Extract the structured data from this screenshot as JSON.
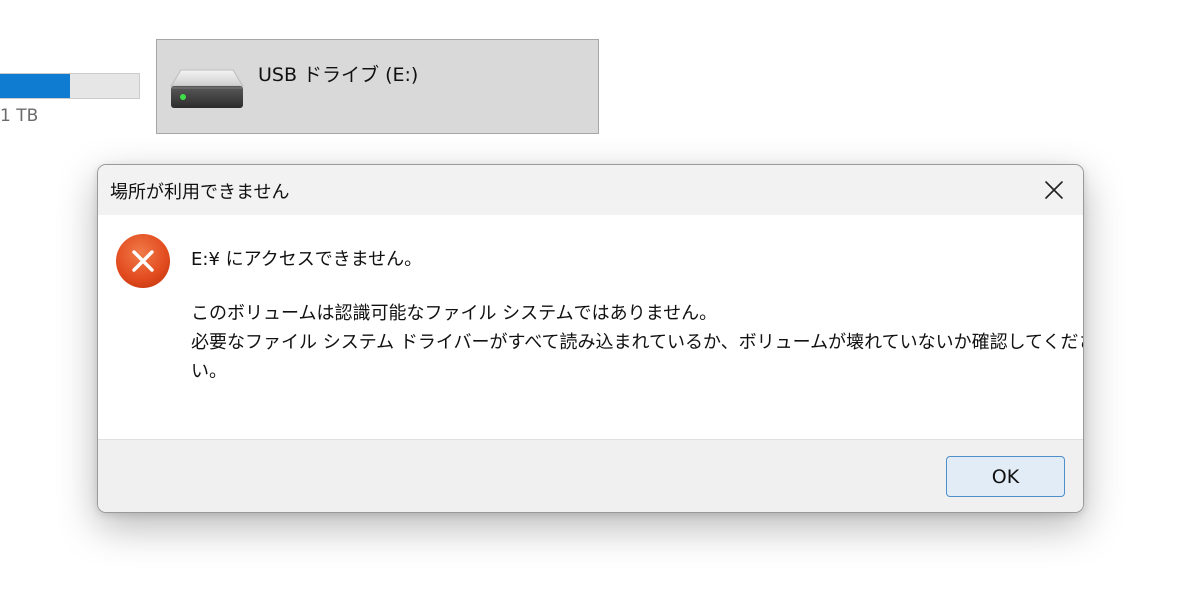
{
  "background": {
    "drive_capacity": {
      "used_fraction": 0.5,
      "size_text": "1 TB"
    },
    "usb_drive": {
      "label": "USB ドライブ (E:)",
      "icon": "usb-drive-icon"
    }
  },
  "dialog": {
    "title": "場所が利用できません",
    "close_icon": "close-icon",
    "icon": "error-icon",
    "message": "E:¥ にアクセスできません。",
    "detail_lines": [
      "このボリュームは認識可能なファイル システムではありません。",
      "必要なファイル システム ドライバーがすべて読み込まれているか、ボリュームが壊れていないか確認してくださ",
      "い。"
    ],
    "ok_label": "OK"
  },
  "colors": {
    "accent": "#0f7bd1",
    "error": "#e24b1e",
    "tile_selected": "#d9d9d9",
    "button_focus_border": "#4f8fc9"
  }
}
